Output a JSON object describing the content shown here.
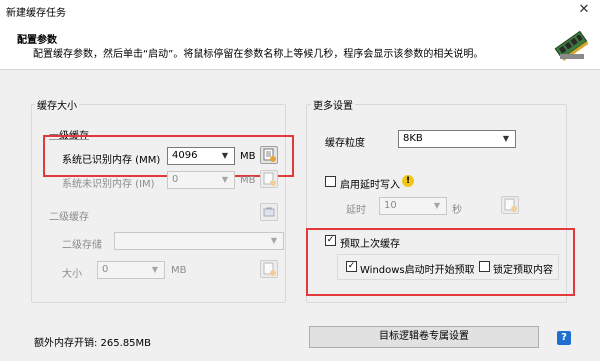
{
  "window": {
    "title": "新建缓存任务"
  },
  "header": {
    "title": "配置参数",
    "description": "配置缓存参数，然后单击“启动”。将鼠标停留在参数名称上等候几秒，程序会显示该参数的相关说明。"
  },
  "cache_size": {
    "group_title": "缓存大小",
    "level1": {
      "title": "一级缓存",
      "recognized_memory_label": "系统已识别内存 (MM)",
      "recognized_memory_value": "4096",
      "recognized_memory_unit": "MB",
      "unrecognized_memory_label": "系统未识别内存 (IM)",
      "unrecognized_memory_value": "0",
      "unrecognized_memory_unit": "MB"
    },
    "level2": {
      "title": "二级缓存",
      "storage_label": "二级存储",
      "storage_value": "",
      "size_label": "大小",
      "size_value": "0",
      "size_unit": "MB"
    },
    "extra_memory": "额外内存开销: 265.85MB"
  },
  "more_settings": {
    "group_title": "更多设置",
    "granularity_label": "缓存粒度",
    "granularity_value": "8KB",
    "defer_write_label": "启用延时写入",
    "defer_write_checked": false,
    "delay_label": "延时",
    "delay_value": "10",
    "delay_unit": "秒",
    "prefetch_label": "预取上次缓存",
    "prefetch_checked": true,
    "windows_prefetch_label": "Windows启动时开始预取",
    "windows_prefetch_checked": true,
    "lock_prefetch_label": "锁定预取内容",
    "lock_prefetch_checked": false
  },
  "footer": {
    "target_button_label": "目标逻辑卷专属设置",
    "help_label": "?"
  },
  "colors": {
    "highlight": "#e03a3a",
    "help_blue": "#1e6fd1",
    "warning_yellow": "#f2c617"
  }
}
